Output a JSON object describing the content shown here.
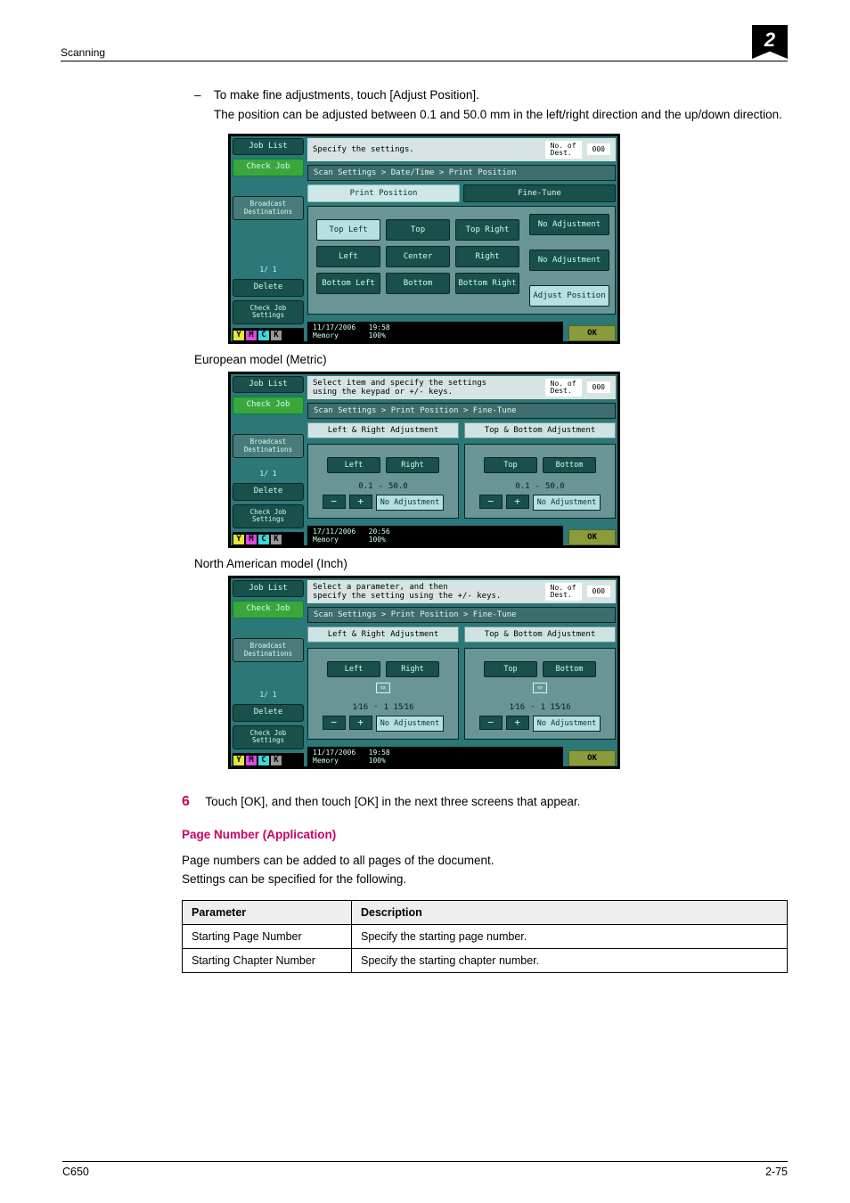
{
  "header": {
    "running_head": "Scanning",
    "chapter_num": "2"
  },
  "bullet": {
    "line1": "To make fine adjustments, touch [Adjust Position].",
    "line2": "The position can be adjusted between 0.1 and 50.0 mm in the left/right direction and the up/down direction."
  },
  "captions": {
    "euro": "European model (Metric)",
    "na": "North American model (Inch)"
  },
  "panel1": {
    "title": "Specify the settings.",
    "count_label": "No. of\nDest.",
    "count": "000",
    "side": {
      "joblist": "Job List",
      "checkjob": "Check Job",
      "broadcast": "Broadcast\nDestinations",
      "page": "1/  1",
      "delete": "Delete",
      "checkjobsettings": "Check Job\nSettings"
    },
    "crumb": "Scan Settings > Date/Time > Print Position",
    "tabs": {
      "pos": "Print Position",
      "fine": "Fine-Tune"
    },
    "positions": {
      "tl": "Top Left",
      "t": "Top",
      "tr": "Top Right",
      "l": "Left",
      "c": "Center",
      "r": "Right",
      "bl": "Bottom Left",
      "b": "Bottom",
      "br": "Bottom Right"
    },
    "right_col": {
      "noadj": "No Adjustment",
      "adjust": "Adjust Position"
    },
    "status": {
      "date": "11/17/2006",
      "time": "19:58",
      "memory": "Memory",
      "pct": "100%"
    },
    "ok": "OK"
  },
  "panel2": {
    "title": "Select item and specify the settings\nusing the keypad or +/- keys.",
    "crumb": "Scan Settings > Print Position > Fine-Tune",
    "left_sec": "Left & Right Adjustment",
    "right_sec": "Top & Bottom Adjustment",
    "left_btns": {
      "left": "Left",
      "right": "Right"
    },
    "right_btns": {
      "top": "Top",
      "bottom": "Bottom"
    },
    "range": {
      "lo": "0.1",
      "hi": "50.0"
    },
    "noadj": "No Adjustment",
    "status": {
      "date": "17/11/2006",
      "time": "20:56",
      "memory": "Memory",
      "pct": "100%"
    }
  },
  "panel3": {
    "title": "Select a parameter, and then\nspecify the setting using the +/- keys.",
    "crumb": "Scan Settings > Print Position > Fine-Tune",
    "range": {
      "lo_frac": "1⁄16",
      "hi": "1 15⁄16"
    },
    "arrow": "⇔",
    "status": {
      "date": "11/17/2006",
      "time": "19:58",
      "memory": "Memory",
      "pct": "100%"
    }
  },
  "step6": {
    "num": "6",
    "text": "Touch [OK], and then touch [OK] in the next three screens that appear."
  },
  "pagenum": {
    "heading": "Page Number (Application)",
    "p1": "Page numbers can be added to all pages of the document.",
    "p2": "Settings can be specified for the following.",
    "th_param": "Parameter",
    "th_desc": "Description",
    "rows": [
      {
        "param": "Starting Page Number",
        "desc": "Specify the starting page number."
      },
      {
        "param": "Starting Chapter Number",
        "desc": "Specify the starting chapter number."
      }
    ]
  },
  "footer": {
    "left": "C650",
    "right": "2-75"
  }
}
